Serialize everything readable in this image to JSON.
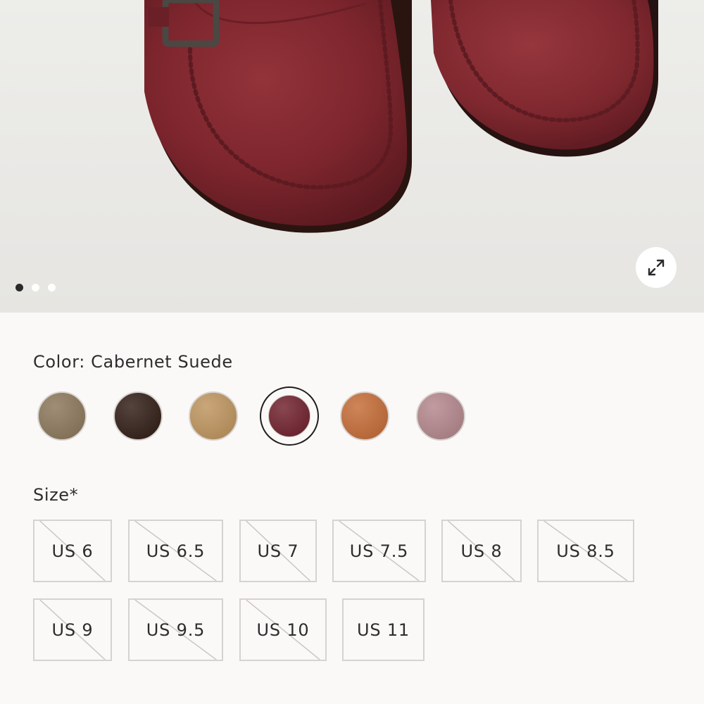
{
  "gallery": {
    "image_alt": "",
    "slide_count": 3,
    "active_slide": 1
  },
  "color": {
    "label": "Color: Cabernet Suede",
    "swatches": [
      {
        "name": "",
        "hex": "#8a7558"
      },
      {
        "name": "",
        "hex": "#2e1a12"
      },
      {
        "name": "",
        "hex": "#bd935c"
      },
      {
        "name": "Cabernet Suede",
        "hex": "#6e1e2a",
        "selected": true
      },
      {
        "name": "",
        "hex": "#c46a34"
      },
      {
        "name": "",
        "hex": "#b2858b"
      }
    ]
  },
  "size": {
    "label": "Size*",
    "options": [
      "US 6",
      "US 6.5",
      "US 7",
      "US 7.5",
      "US 8",
      "US 8.5",
      "US 9",
      "US 9.5",
      "US 10",
      "US 11"
    ],
    "unavailable": [
      "US 6",
      "US 6.5",
      "US 7",
      "US 7.5",
      "US 8",
      "US 8.5",
      "US 9",
      "US 9.5",
      "US 10"
    ]
  },
  "icons": {
    "expand": "expand-arrows-icon"
  }
}
